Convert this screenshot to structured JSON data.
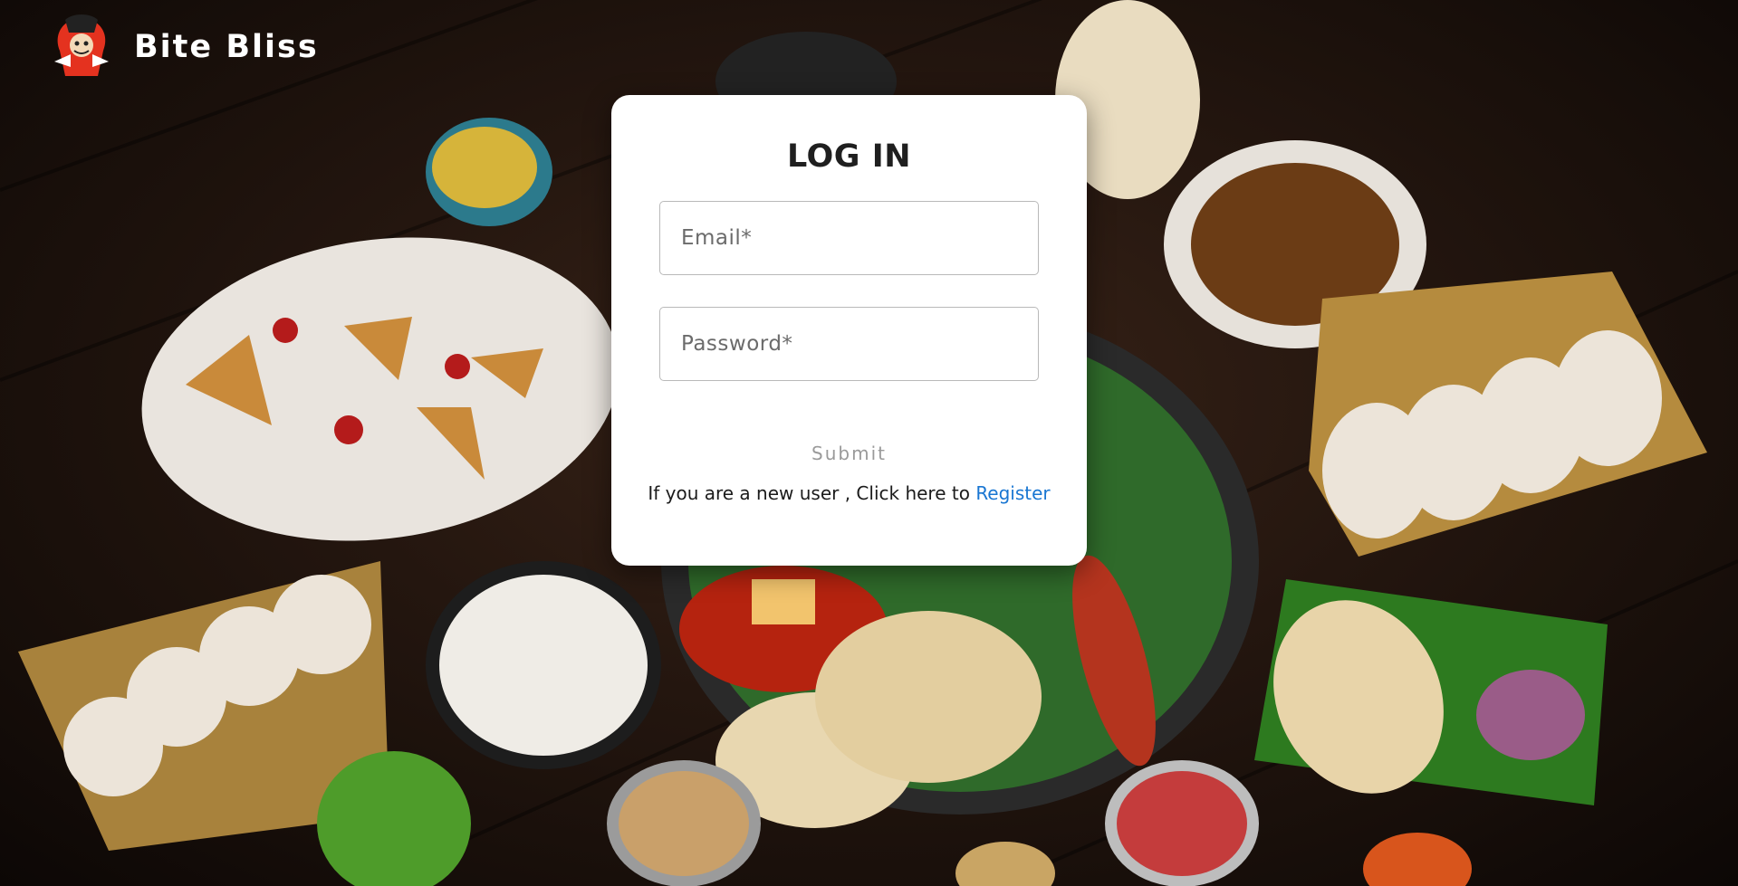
{
  "brand": {
    "name": "Bite Bliss",
    "logo_icon": "chef-mascot-logo-icon"
  },
  "login": {
    "title": "LOG IN",
    "email_placeholder": "Email*",
    "password_placeholder": "Password*",
    "submit_label": "Submit",
    "register_prompt": "If you are a new user , Click here to",
    "register_link": "Register"
  },
  "colors": {
    "link": "#1976d2",
    "card": "#ffffff",
    "submit_text": "#9a9a9a"
  }
}
